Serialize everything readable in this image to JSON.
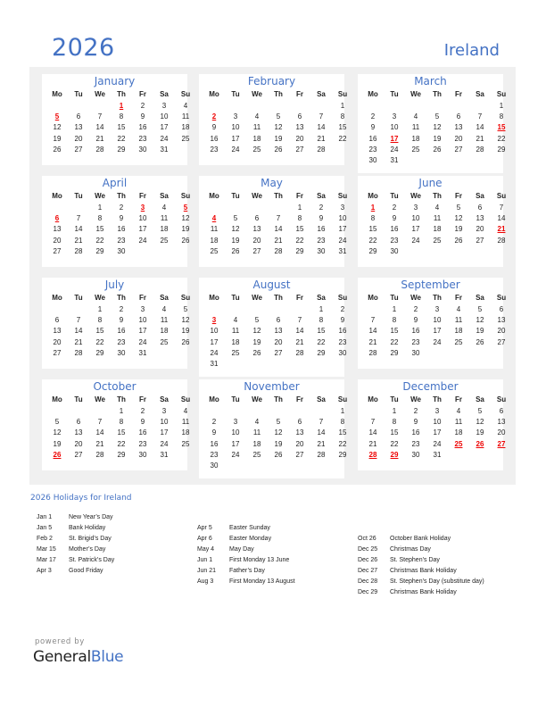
{
  "header": {
    "year": "2026",
    "country": "Ireland"
  },
  "weekdays": [
    "Mo",
    "Tu",
    "We",
    "Th",
    "Fr",
    "Sa",
    "Su"
  ],
  "colors": {
    "accent": "#4472C4",
    "holiday": "#ee0000",
    "panel": "#f0f0f0"
  },
  "months": [
    {
      "name": "January",
      "offset": 3,
      "days": 31,
      "holidays": [
        1,
        5
      ]
    },
    {
      "name": "February",
      "offset": 6,
      "days": 28,
      "holidays": [
        2
      ]
    },
    {
      "name": "March",
      "offset": 6,
      "days": 31,
      "holidays": [
        15,
        17
      ]
    },
    {
      "name": "April",
      "offset": 2,
      "days": 30,
      "holidays": [
        3,
        5,
        6
      ]
    },
    {
      "name": "May",
      "offset": 4,
      "days": 31,
      "holidays": [
        4
      ]
    },
    {
      "name": "June",
      "offset": 0,
      "days": 30,
      "holidays": [
        1,
        21
      ]
    },
    {
      "name": "July",
      "offset": 2,
      "days": 31,
      "holidays": []
    },
    {
      "name": "August",
      "offset": 5,
      "days": 31,
      "holidays": [
        3
      ]
    },
    {
      "name": "September",
      "offset": 1,
      "days": 30,
      "holidays": []
    },
    {
      "name": "October",
      "offset": 3,
      "days": 31,
      "holidays": [
        26
      ]
    },
    {
      "name": "November",
      "offset": 6,
      "days": 30,
      "holidays": []
    },
    {
      "name": "December",
      "offset": 1,
      "days": 31,
      "holidays": [
        25,
        26,
        27,
        28,
        29
      ]
    }
  ],
  "holidays_title": "2026 Holidays for Ireland",
  "holiday_columns": [
    [
      {
        "date": "Jan 1",
        "name": "New Year’s Day"
      },
      {
        "date": "Jan 5",
        "name": "Bank Holiday"
      },
      {
        "date": "Feb 2",
        "name": "St. Brigid’s Day"
      },
      {
        "date": "Mar 15",
        "name": "Mother’s Day"
      },
      {
        "date": "Mar 17",
        "name": "St. Patrick’s Day"
      },
      {
        "date": "Apr 3",
        "name": "Good Friday"
      }
    ],
    [
      {
        "date": "Apr 5",
        "name": "Easter Sunday"
      },
      {
        "date": "Apr 6",
        "name": "Easter Monday"
      },
      {
        "date": "May 4",
        "name": "May Day"
      },
      {
        "date": "Jun 1",
        "name": "First Monday 13 June"
      },
      {
        "date": "Jun 21",
        "name": "Father’s Day"
      },
      {
        "date": "Aug 3",
        "name": "First Monday 13 August"
      }
    ],
    [
      {
        "date": "Oct 26",
        "name": "October Bank Holiday"
      },
      {
        "date": "Dec 25",
        "name": "Christmas Day"
      },
      {
        "date": "Dec 26",
        "name": "St. Stephen’s Day"
      },
      {
        "date": "Dec 27",
        "name": "Christmas Bank Holiday"
      },
      {
        "date": "Dec 28",
        "name": "St. Stephen’s Day (substitute day)"
      },
      {
        "date": "Dec 29",
        "name": "Christmas Bank Holiday"
      }
    ]
  ],
  "footer": {
    "powered_by": "powered by",
    "brand_general": "General",
    "brand_blue": "Blue"
  }
}
